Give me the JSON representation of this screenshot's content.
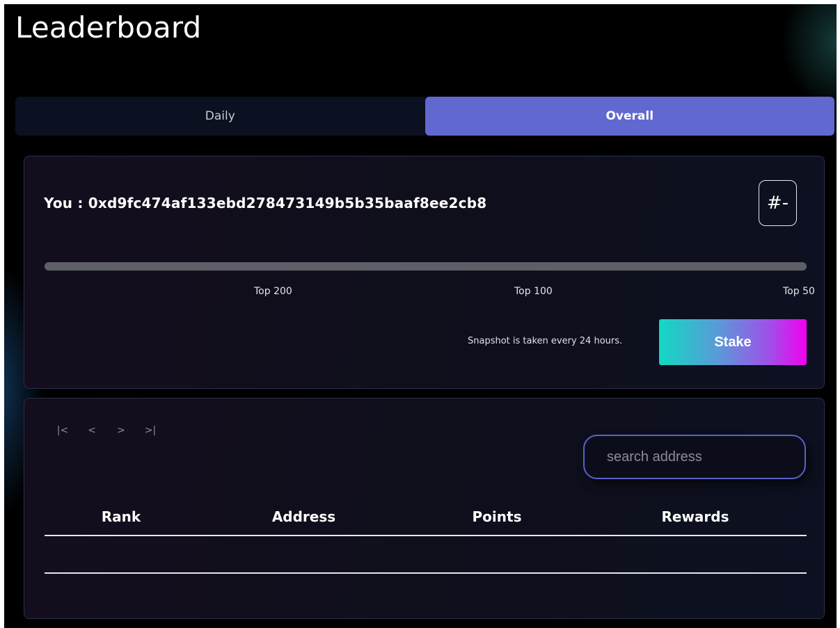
{
  "page": {
    "title": "Leaderboard"
  },
  "tabs": [
    {
      "label": "Daily",
      "active": false
    },
    {
      "label": "Overall",
      "active": true
    }
  ],
  "you": {
    "label": "You : 0xd9fc474af133ebd278473149b5b35baaf8ee2cb8",
    "rank": "#-"
  },
  "progress": {
    "fraction": 0,
    "milestones": [
      "Top 200",
      "Top 100",
      "Top 50"
    ]
  },
  "snapshot": {
    "note": "Snapshot is taken every 24 hours.",
    "stake_label": "Stake"
  },
  "pager": {
    "first": "|<",
    "prev": "<",
    "next": ">",
    "last": ">|"
  },
  "search": {
    "placeholder": "search address",
    "value": ""
  },
  "table": {
    "columns": [
      "Rank",
      "Address",
      "Points",
      "Rewards"
    ],
    "rows": []
  },
  "colors": {
    "accent": "#6168d0",
    "stake_gradient_start": "#12d9c2",
    "stake_gradient_end": "#f200f0",
    "progress_track": "#5e5e66"
  }
}
